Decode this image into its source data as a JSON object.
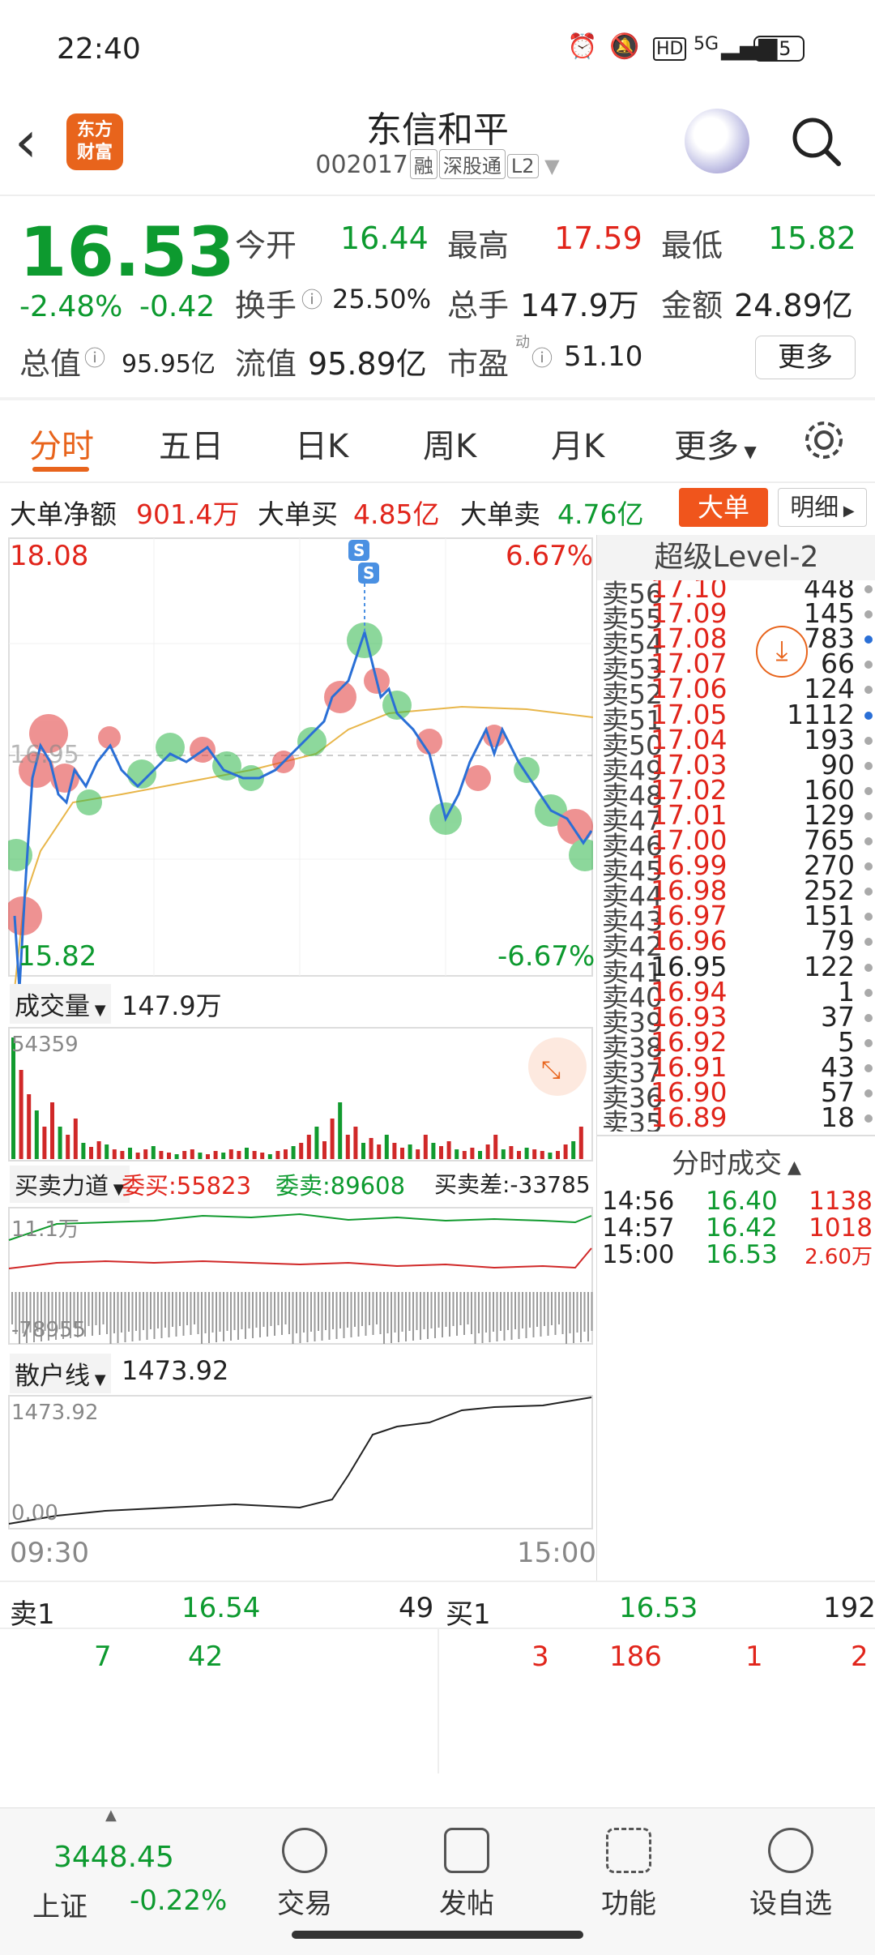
{
  "status": {
    "time": "22:40",
    "battery": "25",
    "network": "5G"
  },
  "header": {
    "logo_text": "东方\n财富",
    "name": "东信和平",
    "code": "002017",
    "tags": [
      "融",
      "深股通",
      "L2"
    ]
  },
  "quote": {
    "price": "16.53",
    "change_pct": "-2.48%",
    "change": "-0.42",
    "open_label": "今开",
    "open": "16.44",
    "high_label": "最高",
    "high": "17.59",
    "low_label": "最低",
    "low": "15.82",
    "turnover_label": "换手",
    "turnover": "25.50%",
    "volume_label": "总手",
    "volume": "147.9万",
    "amount_label": "金额",
    "amount": "24.89亿",
    "mktcap_label": "总值",
    "mktcap": "95.95亿",
    "float_label": "流值",
    "float": "95.89亿",
    "pe_label": "市盈",
    "pe_sup": "动",
    "pe": "51.10",
    "more": "更多"
  },
  "tabs": [
    "分时",
    "五日",
    "日K",
    "周K",
    "月K",
    "更多"
  ],
  "bigorder": {
    "net_label": "大单净额",
    "net": "901.4万",
    "buy_label": "大单买",
    "buy": "4.85亿",
    "sell_label": "大单卖",
    "sell": "4.76亿",
    "btn_big": "大单",
    "btn_detail": "明细"
  },
  "chart": {
    "top_price": "18.08",
    "top_pct": "6.67%",
    "bottom_price": "15.82",
    "bottom_pct": "-6.67%",
    "mid_price": "16.95",
    "volume_label": "成交量",
    "volume": "147.9万",
    "vol_max": "54359",
    "force_label": "买卖力道",
    "force_buy": "委买:55823",
    "force_sell": "委卖:89608",
    "force_diff": "买卖差:-33785",
    "force_top": "11.1万",
    "force_bottom": "-78955",
    "retail_label": "散户线",
    "retail": "1473.92",
    "retail_top": "1473.92",
    "retail_bottom": "0.00",
    "time_start": "09:30",
    "time_end": "15:00"
  },
  "orderbook": {
    "title": "超级Level-2",
    "rows": [
      {
        "label": "卖56",
        "price": "17.10",
        "vol": "448"
      },
      {
        "label": "卖55",
        "price": "17.09",
        "vol": "145"
      },
      {
        "label": "卖54",
        "price": "17.08",
        "vol": "783"
      },
      {
        "label": "卖53",
        "price": "17.07",
        "vol": "66"
      },
      {
        "label": "卖52",
        "price": "17.06",
        "vol": "124"
      },
      {
        "label": "卖51",
        "price": "17.05",
        "vol": "1112"
      },
      {
        "label": "卖50",
        "price": "17.04",
        "vol": "193"
      },
      {
        "label": "卖49",
        "price": "17.03",
        "vol": "90"
      },
      {
        "label": "卖48",
        "price": "17.02",
        "vol": "160"
      },
      {
        "label": "卖47",
        "price": "17.01",
        "vol": "129"
      },
      {
        "label": "卖46",
        "price": "17.00",
        "vol": "765"
      },
      {
        "label": "卖45",
        "price": "16.99",
        "vol": "270"
      },
      {
        "label": "卖44",
        "price": "16.98",
        "vol": "252"
      },
      {
        "label": "卖43",
        "price": "16.97",
        "vol": "151"
      },
      {
        "label": "卖42",
        "price": "16.96",
        "vol": "79"
      },
      {
        "label": "卖41",
        "price": "16.95",
        "vol": "122"
      },
      {
        "label": "卖40",
        "price": "16.94",
        "vol": "1"
      },
      {
        "label": "卖39",
        "price": "16.93",
        "vol": "37"
      },
      {
        "label": "卖38",
        "price": "16.92",
        "vol": "5"
      },
      {
        "label": "卖37",
        "price": "16.91",
        "vol": "43"
      },
      {
        "label": "卖36",
        "price": "16.90",
        "vol": "57"
      },
      {
        "label": "卖35",
        "price": "16.89",
        "vol": "18"
      }
    ],
    "ticks_title": "分时成交",
    "ticks": [
      {
        "time": "14:56",
        "price": "16.40",
        "vol": "1138"
      },
      {
        "time": "14:57",
        "price": "16.42",
        "vol": "1018"
      },
      {
        "time": "15:00",
        "price": "16.53",
        "vol": "2.60万"
      }
    ]
  },
  "bottomquote": {
    "sell1_label": "卖1",
    "sell1_price": "16.54",
    "sell1_vol": "49",
    "buy1_label": "买1",
    "buy1_price": "16.53",
    "buy1_vol": "192",
    "sell_q": [
      "7",
      "42"
    ],
    "buy_q": [
      "3",
      "186",
      "1",
      "2"
    ]
  },
  "bottombar": {
    "index_value": "3448.45",
    "index_name": "上证",
    "index_change": "-0.22%",
    "items": [
      "交易",
      "发帖",
      "功能",
      "设自选"
    ]
  }
}
